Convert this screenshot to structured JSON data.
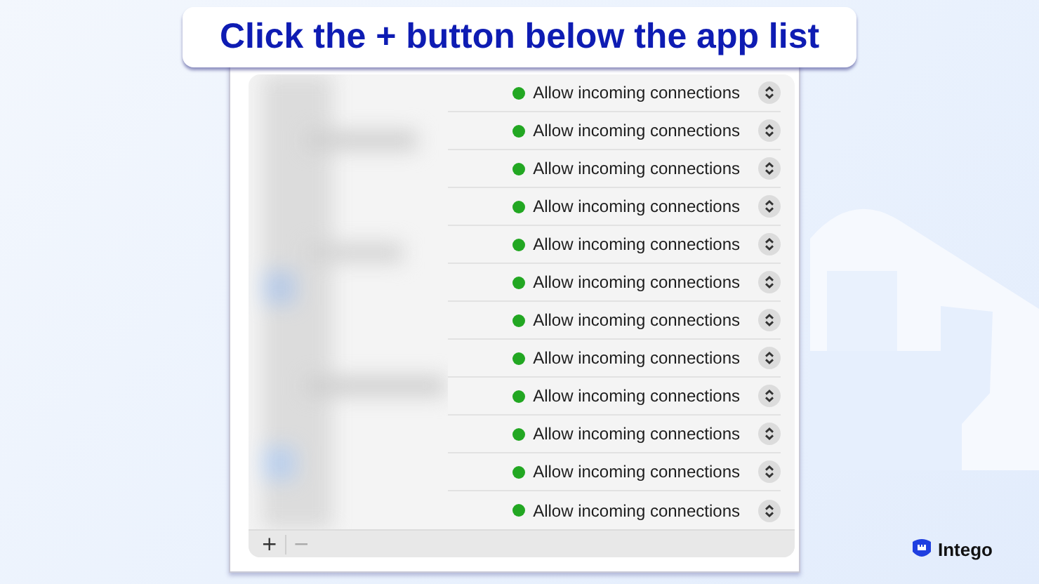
{
  "banner": {
    "text": "Click the + button below the app list"
  },
  "apps": [
    {
      "allowed": true,
      "label": "Allow incoming connections"
    },
    {
      "allowed": true,
      "label": "Allow incoming connections"
    },
    {
      "allowed": true,
      "label": "Allow incoming connections"
    },
    {
      "allowed": true,
      "label": "Allow incoming connections"
    },
    {
      "allowed": true,
      "label": "Allow incoming connections"
    },
    {
      "allowed": true,
      "label": "Allow incoming connections"
    },
    {
      "allowed": true,
      "label": "Allow incoming connections"
    },
    {
      "allowed": true,
      "label": "Allow incoming connections"
    },
    {
      "allowed": true,
      "label": "Allow incoming connections"
    },
    {
      "allowed": true,
      "label": "Allow incoming connections"
    },
    {
      "allowed": true,
      "label": "Allow incoming connections"
    },
    {
      "allowed": true,
      "label": "Allow incoming connections"
    }
  ],
  "footer": {
    "add": "+",
    "remove": "−"
  },
  "brand": {
    "name": "Intego"
  }
}
